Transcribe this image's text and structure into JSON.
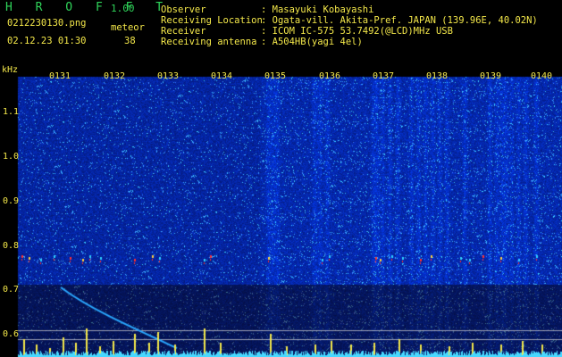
{
  "header": {
    "app_name": "H R O F F T",
    "version": "1.00",
    "filename": "0212230130.png",
    "meteor_label": "meteor",
    "meteor_count": "38",
    "datetime": "02.12.23 01:30"
  },
  "station": {
    "observer_label": "Observer",
    "observer_value": ": Masayuki Kobayashi",
    "location_label": "Receiving Location",
    "location_value": ": Ogata-vill. Akita-Pref. JAPAN (139.96E, 40.02N)",
    "receiver_label": "Receiver",
    "receiver_value": ": ICOM IC-575 53.7492(@LCD)MHz USB",
    "antenna_label": "Receiving antenna",
    "antenna_value": ": A504HB(yagi 4el)"
  },
  "spectrogram": {
    "y_unit": "kHz",
    "y_ticks": [
      "1.1",
      "1.0",
      "0.9",
      "0.8",
      "0.7",
      "0.6"
    ],
    "x_ticks": [
      "0131",
      "0132",
      "0133",
      "0134",
      "0135",
      "0136",
      "0137",
      "0138",
      "0139",
      "0140"
    ],
    "colors": {
      "background": "#04107a",
      "speckle": "#2a5cff",
      "echo": "#ff2a2a",
      "tick": "#f4e84a",
      "trace": "#2aa8ff"
    }
  }
}
